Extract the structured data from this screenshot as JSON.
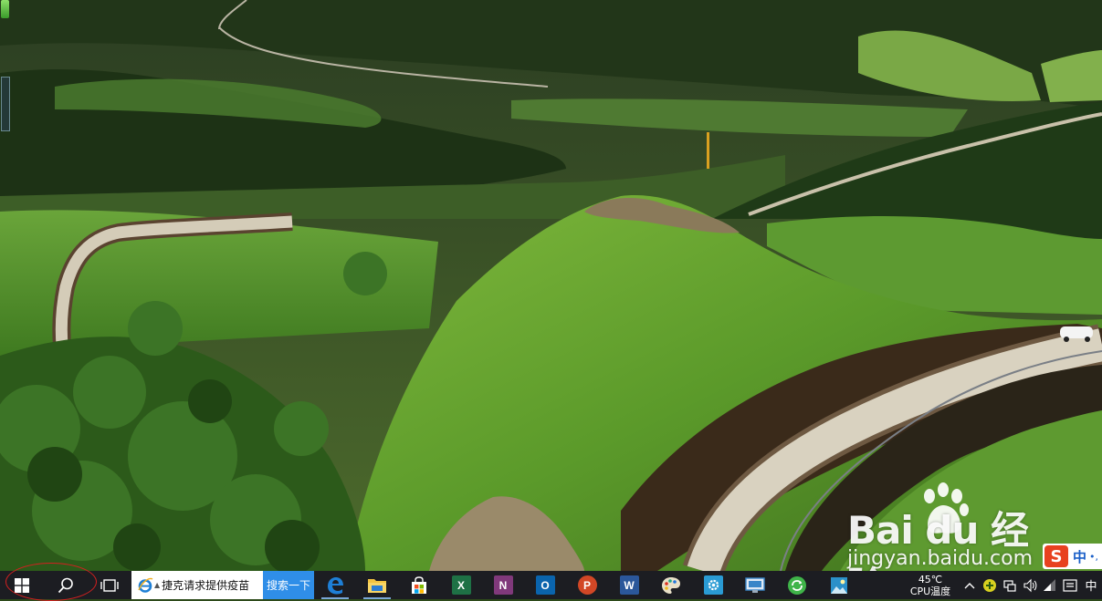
{
  "watermark": {
    "logo_text": "Bai du 经验",
    "url": "jingyan.baidu.com"
  },
  "ime": {
    "logo": "S",
    "mode": "中",
    "punct": "•,"
  },
  "taskbar": {
    "start_icon": "windows-logo-icon",
    "search_icon": "magnifier-icon",
    "task_view_icon": "task-view-icon",
    "search_box_text": "捷克请求提供疫苗",
    "search_button": "搜索一下",
    "apps": [
      {
        "name": "edge",
        "icon": "edge-icon",
        "color": "#1e7fd6"
      },
      {
        "name": "file-explorer",
        "icon": "folder-icon",
        "color": "#f3c340"
      },
      {
        "name": "store",
        "icon": "store-bag-icon",
        "color": "#ffffff"
      },
      {
        "name": "excel",
        "icon": "excel-icon",
        "color": "#1e7145",
        "letter": "X"
      },
      {
        "name": "onenote",
        "icon": "onenote-icon",
        "color": "#80397b",
        "letter": "N"
      },
      {
        "name": "outlook",
        "icon": "outlook-icon",
        "color": "#0a64ad",
        "letter": "O"
      },
      {
        "name": "powerpoint",
        "icon": "powerpoint-icon",
        "color": "#d24726",
        "letter": "P"
      },
      {
        "name": "word",
        "icon": "word-icon",
        "color": "#2b579a",
        "letter": "W"
      },
      {
        "name": "paint",
        "icon": "paint-palette-icon",
        "color": "#e8e0c8"
      },
      {
        "name": "settings",
        "icon": "gear-icon",
        "color": "#2a9bd4"
      },
      {
        "name": "remote-desktop",
        "icon": "monitor-icon",
        "color": "#3a86c8"
      },
      {
        "name": "refresh-app",
        "icon": "green-refresh-icon",
        "color": "#3fb449"
      },
      {
        "name": "photos",
        "icon": "photo-icon",
        "color": "#2b90c9"
      }
    ]
  },
  "tray": {
    "temperature": "45℃",
    "temperature_label": "CPU温度",
    "chevron": "^",
    "language": "中",
    "icons": [
      "add-circle-icon",
      "network-adapter-icon",
      "speaker-icon",
      "wifi-icon",
      "keyboard-icon"
    ]
  }
}
